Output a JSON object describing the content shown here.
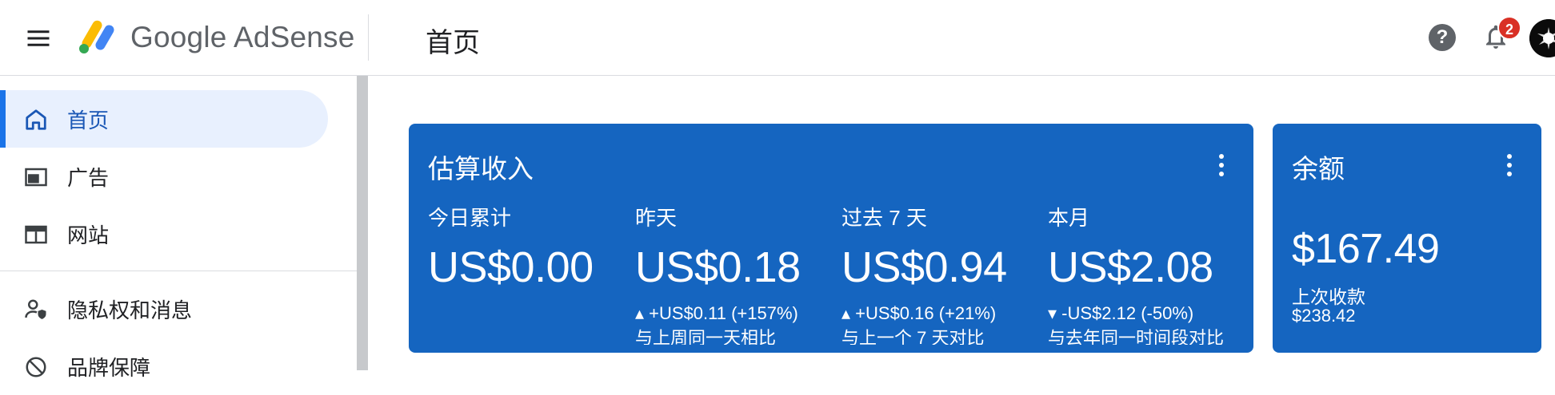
{
  "header": {
    "menu_icon": "hamburger-menu-icon",
    "brand_google": "Google",
    "brand_product": "AdSense",
    "page_title": "首页",
    "help_icon": "help-icon",
    "help_glyph": "?",
    "notifications_icon": "bell-icon",
    "notifications_count": "2",
    "avatar_icon": "user-avatar"
  },
  "sidebar": {
    "items": [
      {
        "label": "首页",
        "icon": "home-icon",
        "active": true
      },
      {
        "label": "广告",
        "icon": "ads-icon",
        "active": false
      },
      {
        "label": "网站",
        "icon": "sites-icon",
        "active": false
      },
      {
        "label": "隐私权和消息",
        "icon": "privacy-messaging-icon",
        "active": false
      },
      {
        "label": "品牌保障",
        "icon": "block-icon",
        "active": false
      }
    ]
  },
  "earnings_card": {
    "title": "估算收入",
    "metrics": [
      {
        "label": "今日累计",
        "value": "US$0.00",
        "delta": "",
        "compare": ""
      },
      {
        "label": "昨天",
        "value": "US$0.18",
        "delta": "▴ +US$0.11 (+157%)",
        "compare": "与上周同一天相比"
      },
      {
        "label": "过去 7 天",
        "value": "US$0.94",
        "delta": "▴ +US$0.16 (+21%)",
        "compare": "与上一个 7 天对比"
      },
      {
        "label": "本月",
        "value": "US$2.08",
        "delta": "▾ -US$2.12 (-50%)",
        "compare": "与去年同一时间段对比"
      }
    ]
  },
  "balance_card": {
    "title": "余额",
    "value": "$167.49",
    "last_payment_label": "上次收款",
    "last_payment_value": "$238.42"
  },
  "colors": {
    "card_blue": "#1565c0",
    "active_nav_bg": "#e8f0fe",
    "accent_blue": "#1a73e8",
    "badge_red": "#d93025"
  }
}
